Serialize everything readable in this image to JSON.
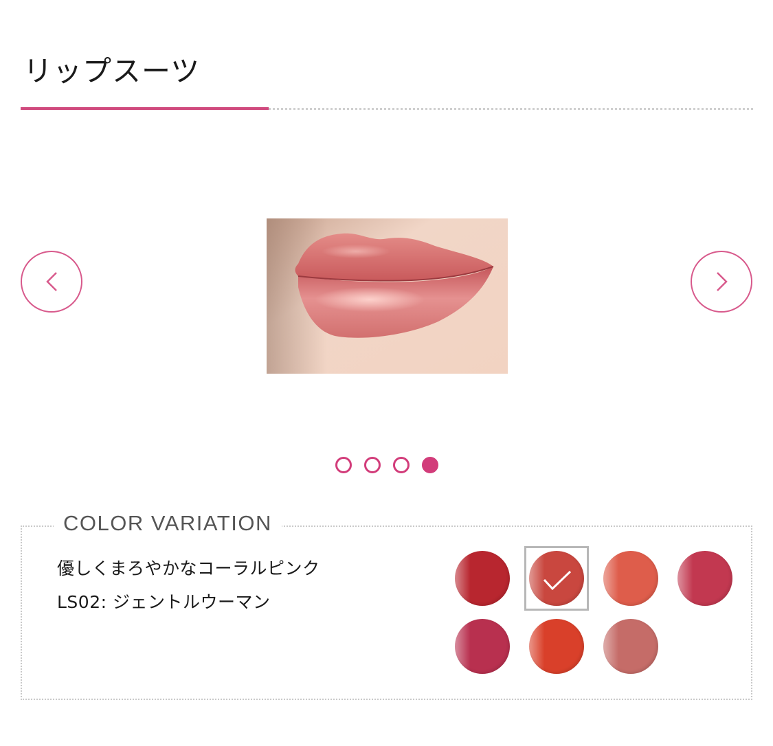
{
  "header": {
    "title": "リップスーツ"
  },
  "carousel": {
    "prev_icon": "chevron-left-icon",
    "next_icon": "chevron-right-icon",
    "image": "lips-photo-coral-pink",
    "page_count": 4,
    "active_page": 4
  },
  "color_variation": {
    "heading": "COLOR VARIATION",
    "description": "優しくまろやかなコーラルピンク",
    "shade_code": "LS02: ジェントルウーマン",
    "selected_index": 1,
    "swatches": [
      {
        "color": "#b8262f"
      },
      {
        "color": "#c9473f"
      },
      {
        "color": "#de5d4b"
      },
      {
        "color": "#c23850"
      },
      {
        "color": "#b8304f"
      },
      {
        "color": "#d9402a"
      },
      {
        "color": "#c56c68"
      }
    ]
  },
  "colors": {
    "accent": "#d04a7e",
    "pager_accent": "#d23c7a",
    "arrow_border": "#d85a8c"
  }
}
